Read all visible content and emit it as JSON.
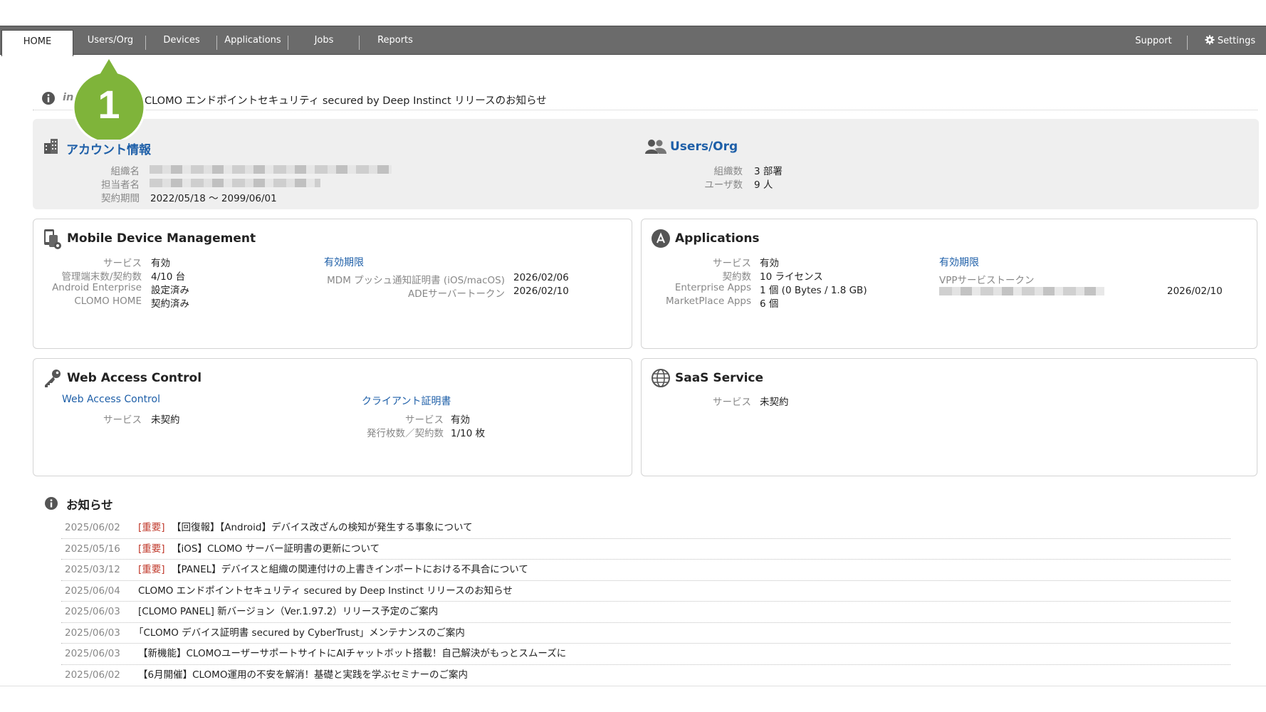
{
  "nav": {
    "tabs": [
      "HOME",
      "Users/Org",
      "Devices",
      "Applications",
      "Jobs",
      "Reports"
    ],
    "support": "Support",
    "settings": "Settings"
  },
  "info_line": {
    "tag": "in",
    "text": "CLOMO エンドポイントセキュリティ secured by Deep Instinct リリースのお知らせ"
  },
  "callout": {
    "number": "1",
    "color": "#7fb43a"
  },
  "account": {
    "title": "アカウント情報",
    "labels": {
      "org": "組織名",
      "person": "担当者名",
      "period": "契約期間"
    },
    "period_value": "2022/05/18 〜 2099/06/01"
  },
  "users_org": {
    "title": "Users/Org",
    "labels": {
      "orgs": "組織数",
      "users": "ユーザ数"
    },
    "orgs_value": "3 部署",
    "users_value": "9 人"
  },
  "mdm": {
    "title": "Mobile Device Management",
    "labels": [
      "サービス",
      "管理端末数/契約数",
      "Android Enterprise",
      "CLOMO HOME"
    ],
    "values": [
      "有効",
      "4/10 台",
      "設定済み",
      "契約済み"
    ],
    "expiry_link": "有効期限",
    "expiry_labels": [
      "MDM プッシュ通知証明書 (iOS/macOS)",
      "ADEサーバートークン"
    ],
    "expiry_values": [
      "2026/02/06",
      "2026/02/10"
    ]
  },
  "applications": {
    "title": "Applications",
    "labels": [
      "サービス",
      "契約数",
      "Enterprise Apps",
      "MarketPlace Apps"
    ],
    "values": [
      "有効",
      "10 ライセンス",
      "1 個 (0 Bytes / 1.8 GB)",
      "6 個"
    ],
    "expiry_link": "有効期限",
    "vpp_label": "VPPサービストークン",
    "vpp_date": "2026/02/10"
  },
  "wac": {
    "title": "Web Access Control",
    "link": "Web Access Control",
    "service_label": "サービス",
    "service_value": "未契約",
    "cert_link": "クライアント証明書",
    "cert_labels": [
      "サービス",
      "発行枚数／契約数"
    ],
    "cert_values": [
      "有効",
      "1/10 枚"
    ]
  },
  "saas": {
    "title": "SaaS Service",
    "service_label": "サービス",
    "service_value": "未契約"
  },
  "news": {
    "title": "お知らせ",
    "items": [
      {
        "date": "2025/06/02",
        "important": "[重要]",
        "text": "【回復報】【Android】デバイス改ざんの検知が発生する事象について"
      },
      {
        "date": "2025/05/16",
        "important": "[重要]",
        "text": "【iOS】CLOMO サーバー証明書の更新について"
      },
      {
        "date": "2025/03/12",
        "important": "[重要]",
        "text": "【PANEL】デバイスと組織の関連付けの上書きインポートにおける不具合について"
      },
      {
        "date": "2025/06/04",
        "important": "",
        "text": "CLOMO エンドポイントセキュリティ secured by Deep Instinct リリースのお知らせ"
      },
      {
        "date": "2025/06/03",
        "important": "",
        "text": "[CLOMO PANEL] 新バージョン（Ver.1.97.2）リリース予定のご案内"
      },
      {
        "date": "2025/06/03",
        "important": "",
        "text": "「CLOMO デバイス証明書 secured by CyberTrust」メンテナンスのご案内"
      },
      {
        "date": "2025/06/03",
        "important": "",
        "text": "【新機能】CLOMOユーザーサポートサイトにAIチャットボット搭載！自己解決がもっとスムーズに"
      },
      {
        "date": "2025/06/02",
        "important": "",
        "text": "【6月開催】CLOMO運用の不安を解消！基礎と実践を学ぶセミナーのご案内"
      }
    ]
  }
}
